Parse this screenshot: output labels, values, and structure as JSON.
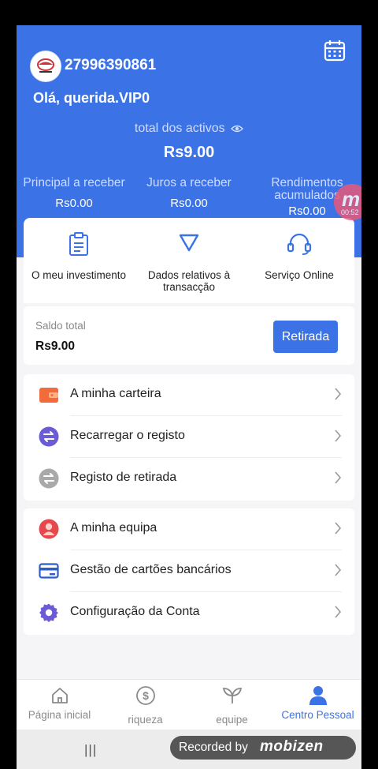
{
  "header": {
    "phone": "27996390861",
    "greeting": "Olá, querida.VIP0",
    "total_label": "total dos activos",
    "total_value": "Rs9.00",
    "stats": [
      {
        "label": "Principal a receber",
        "value": "Rs0.00"
      },
      {
        "label": "Juros a receber",
        "value": "Rs0.00"
      },
      {
        "label": "Rendimentos acumulados",
        "value": "Rs0.00"
      }
    ]
  },
  "recording_badge": {
    "letter": "m",
    "time": "00:52"
  },
  "quick_actions": [
    {
      "label": "O meu investimento",
      "icon": "clipboard-icon"
    },
    {
      "label": "Dados relativos à transacção",
      "icon": "triangle-down-icon"
    },
    {
      "label": "Serviço Online",
      "icon": "headset-icon"
    }
  ],
  "balance": {
    "label": "Saldo total",
    "value": "Rs9.00",
    "withdraw_label": "Retirada"
  },
  "menu_group_1": [
    {
      "label": "A minha carteira",
      "icon": "wallet-icon"
    },
    {
      "label": "Recarregar o registo",
      "icon": "recharge-icon"
    },
    {
      "label": "Registo de retirada",
      "icon": "withdraw-record-icon"
    }
  ],
  "menu_group_2": [
    {
      "label": "A minha equipa",
      "icon": "team-icon"
    },
    {
      "label": "Gestão de cartões bancários",
      "icon": "bank-card-icon"
    },
    {
      "label": "Configuração da Conta",
      "icon": "settings-gear-icon"
    }
  ],
  "tabbar": [
    {
      "label": "Página inicial",
      "icon": "home-icon",
      "active": false
    },
    {
      "label": "riqueza",
      "icon": "dollar-icon",
      "active": false
    },
    {
      "label": "equipe",
      "icon": "sprout-icon",
      "active": false
    },
    {
      "label": "Centro Pessoal",
      "icon": "person-icon",
      "active": true
    }
  ],
  "watermark": {
    "prefix": "Recorded by",
    "brand": "mobizen"
  },
  "colors": {
    "primary": "#3b73e6",
    "wallet": "#f26b3a",
    "recharge": "#6b5bd6",
    "withdraw": "#a9a9a9",
    "team": "#e5484d",
    "card": "#2c5fc9",
    "gear": "#6b5bd6"
  }
}
